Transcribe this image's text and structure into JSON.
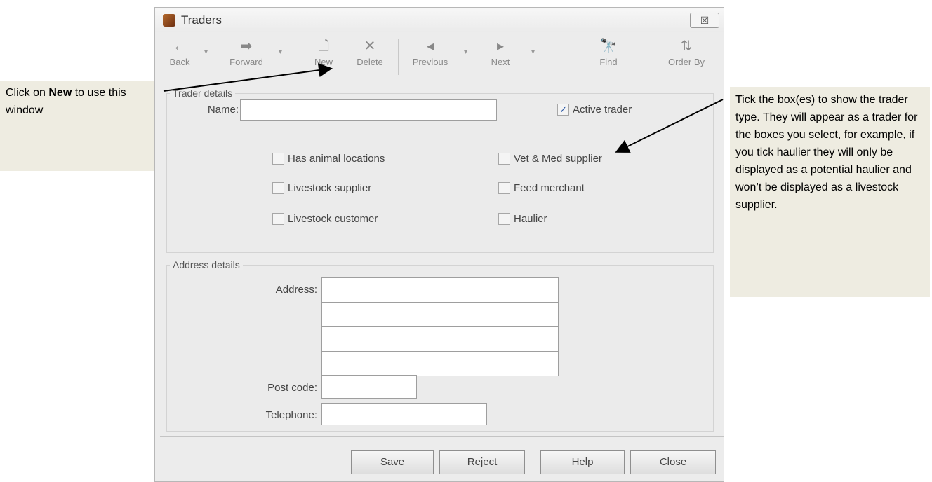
{
  "window": {
    "title": "Traders",
    "close_symbol": "☒"
  },
  "toolbar": {
    "back": {
      "label": "Back",
      "icon": "←"
    },
    "forward": {
      "label": "Forward",
      "icon": "➡"
    },
    "new": {
      "label": "New",
      "icon": "🗋"
    },
    "delete": {
      "label": "Delete",
      "icon": "✕"
    },
    "previous": {
      "label": "Previous",
      "icon": "◂"
    },
    "next": {
      "label": "Next",
      "icon": "▸"
    },
    "find": {
      "label": "Find",
      "icon": "🔭"
    },
    "order_by": {
      "label": "Order By",
      "icon": "⇅"
    },
    "dropdown_symbol": "▾"
  },
  "trader_details": {
    "title": "Trader details",
    "name_label": "Name:",
    "name_value": "",
    "active_trader": {
      "label": "Active trader",
      "checked": true
    },
    "checkboxes": [
      {
        "label": "Has animal locations",
        "checked": false
      },
      {
        "label": "Livestock supplier",
        "checked": false
      },
      {
        "label": "Livestock customer",
        "checked": false
      },
      {
        "label": "Vet & Med supplier",
        "checked": false
      },
      {
        "label": "Feed merchant",
        "checked": false
      },
      {
        "label": "Haulier",
        "checked": false
      }
    ]
  },
  "address_details": {
    "title": "Address details",
    "address_label": "Address:",
    "address_lines": [
      "",
      "",
      "",
      ""
    ],
    "postcode_label": "Post code:",
    "postcode_value": "",
    "telephone_label": "Telephone:",
    "telephone_value": ""
  },
  "buttons": {
    "save": "Save",
    "reject": "Reject",
    "help": "Help",
    "close": "Close"
  },
  "callouts": {
    "left_prefix": "Click on ",
    "left_bold": "New",
    "left_suffix": " to use this window",
    "right": "Tick the box(es) to show the trader type. They will appear as a trader for the boxes you select, for example, if you tick haulier they will only be displayed as a potential haulier and won’t be displayed as a livestock supplier."
  }
}
